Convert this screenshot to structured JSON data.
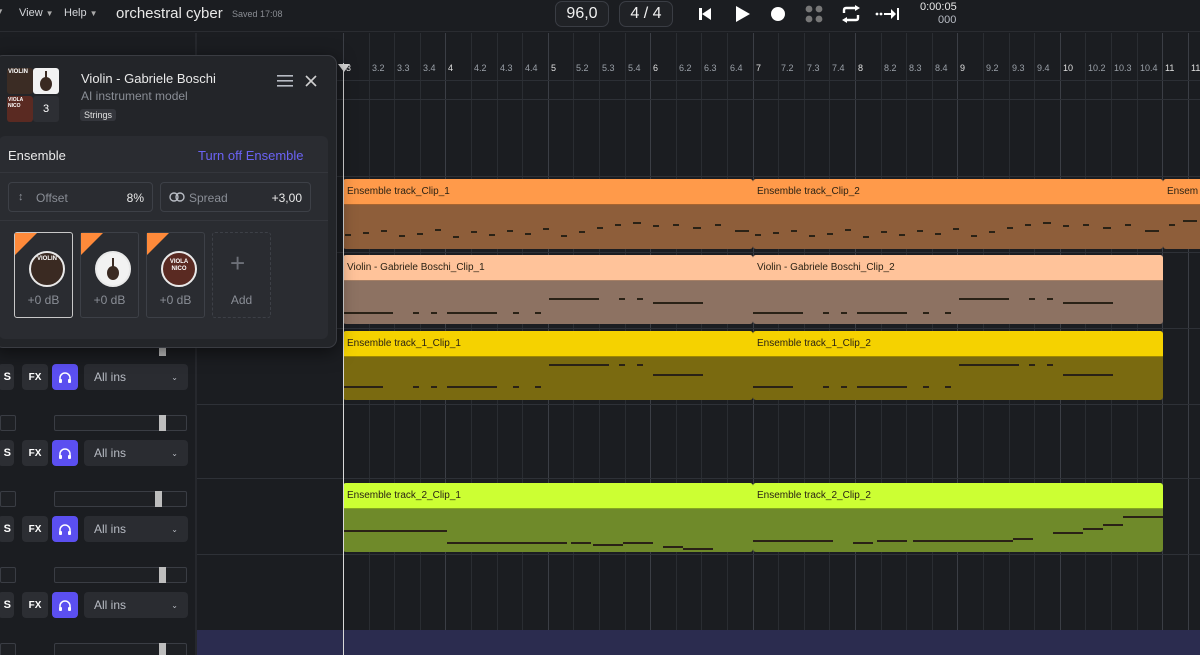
{
  "menu": {
    "view_label": "View",
    "help_label": "Help"
  },
  "project": {
    "title": "orchestral cyber",
    "saved": "Saved 17:08"
  },
  "transport": {
    "tempo": "96,0",
    "time_signature": "4 / 4",
    "time_top": "0:00:05",
    "time_bottom": "000"
  },
  "ruler": {
    "labels": [
      "3",
      "3.2",
      "3.3",
      "3.4",
      "4",
      "4.2",
      "4.3",
      "4.4",
      "5",
      "5.2",
      "5.3",
      "5.4",
      "6",
      "6.2",
      "6.3",
      "6.4",
      "7",
      "7.2",
      "7.3",
      "7.4",
      "8",
      "8.2",
      "8.3",
      "8.4",
      "9",
      "9.2",
      "9.3",
      "9.4",
      "10",
      "10.2",
      "10.3",
      "10.4",
      "11",
      "11"
    ]
  },
  "instrument": {
    "name": "Violin - Gabriele Boschi",
    "subtitle": "AI instrument model",
    "tag": "Strings",
    "count": "3",
    "thumb_label_1": "VIOLIN",
    "thumb_label_2": "VIOLA NICO"
  },
  "ensemble": {
    "title": "Ensemble",
    "turn_off": "Turn off Ensemble",
    "offset_label": "Offset",
    "offset_value": "8%",
    "spread_label": "Spread",
    "spread_value": "+3,00",
    "members": [
      {
        "label": "VIOLIN",
        "gain": "+0 dB"
      },
      {
        "label": "",
        "gain": "+0 dB"
      },
      {
        "label": "VIOLA NICO",
        "gain": "+0 dB"
      }
    ],
    "add_label": "Add"
  },
  "tracks": [
    {
      "solo": "S",
      "fx": "FX",
      "input": "All ins"
    },
    {
      "solo": "S",
      "fx": "FX",
      "input": "All ins"
    },
    {
      "solo": "S",
      "fx": "FX",
      "input": "All ins"
    },
    {
      "solo": "S",
      "fx": "FX",
      "input": "All ins"
    }
  ],
  "clips": {
    "row1": [
      "Ensemble track_Clip_1",
      "Ensemble track_Clip_2",
      "Ensem"
    ],
    "row2": [
      "Violin - Gabriele Boschi_Clip_1",
      "Violin - Gabriele Boschi_Clip_2"
    ],
    "row3": [
      "Ensemble track_1_Clip_1",
      "Ensemble track_1_Clip_2"
    ],
    "row4": [
      "Ensemble track_2_Clip_1",
      "Ensemble track_2_Clip_2"
    ]
  },
  "colors": {
    "clip_orange": "#ff9a4a",
    "clip_orange_body": "#8e5e3a",
    "clip_peach": "#ffc39a",
    "clip_peach_body": "#8d7262",
    "clip_yellow": "#f5d200",
    "clip_yellow_body": "#7a6a10",
    "clip_lime": "#ccff33",
    "clip_lime_body": "#6f8a2a",
    "accent": "#5b4ff0"
  }
}
